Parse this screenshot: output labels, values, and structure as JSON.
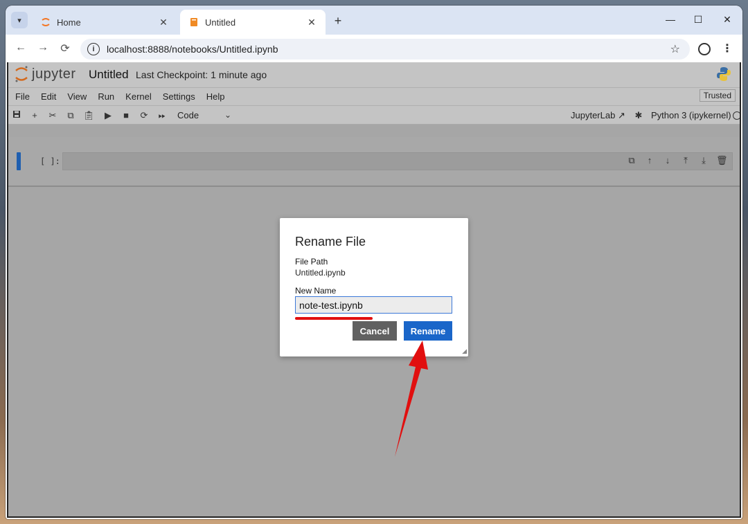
{
  "browser": {
    "tabs": [
      {
        "title": "Home",
        "icon": "jupyter-icon",
        "active": false
      },
      {
        "title": "Untitled",
        "icon": "notebook-icon",
        "active": true
      }
    ],
    "new_tab": "+",
    "url": "localhost:8888/notebooks/Untitled.ipynb",
    "controls": {
      "minimize": "—",
      "maximize": "☐",
      "close": "✕"
    }
  },
  "notebook": {
    "logo_text": "jupyter",
    "name": "Untitled",
    "checkpoint": "Last Checkpoint: 1 minute ago",
    "menu": [
      "File",
      "Edit",
      "View",
      "Run",
      "Kernel",
      "Settings",
      "Help"
    ],
    "trusted": "Trusted",
    "cell_type": "Code",
    "jupyterlab_link": "JupyterLab",
    "kernel": "Python 3 (ipykernel)",
    "cell_prompt": "[ ]:"
  },
  "dialog": {
    "title": "Rename File",
    "file_path_label": "File Path",
    "file_path_value": "Untitled.ipynb",
    "new_name_label": "New Name",
    "new_name_value": "note-test.ipynb",
    "cancel_label": "Cancel",
    "rename_label": "Rename"
  },
  "colors": {
    "accent": "#1a66c9",
    "annotation": "#e10f0f",
    "cancel_bg": "#616161"
  }
}
